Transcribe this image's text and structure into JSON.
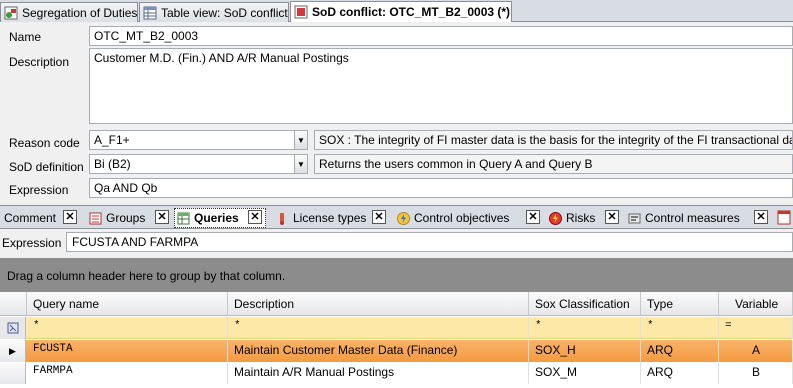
{
  "doc_tabs": [
    {
      "label": "Segregation of Duties"
    },
    {
      "label": "Table view: SoD conflict"
    },
    {
      "label": "SoD conflict: OTC_MT_B2_0003 (*)"
    }
  ],
  "form": {
    "name_label": "Name",
    "name_value": "OTC_MT_B2_0003",
    "description_label": "Description",
    "description_value": "Customer M.D. (Fin.) AND A/R Manual Postings",
    "reason_label": "Reason code",
    "reason_value": "A_F1+",
    "reason_desc": "SOX : The integrity of FI master data is the basis for the integrity of the FI transactional data base",
    "sod_label": "SoD definition",
    "sod_value": "Bi (B2)",
    "sod_desc": "Returns the users common in Query A and Query B",
    "expression_label": "Expression",
    "expression_value": "Qa AND Qb"
  },
  "sub_tabs": [
    {
      "label": "Comment"
    },
    {
      "label": "Groups"
    },
    {
      "label": "Queries"
    },
    {
      "label": "License types"
    },
    {
      "label": "Control objectives"
    },
    {
      "label": "Risks"
    },
    {
      "label": "Control measures"
    }
  ],
  "query_expression": {
    "label": "Expression",
    "value": "FCUSTA AND FARMPA"
  },
  "group_panel_text": "Drag a column header here to group by that column.",
  "grid": {
    "columns": [
      "Query name",
      "Description",
      "Sox Classification",
      "Type",
      "Variable"
    ],
    "filter": [
      "*",
      "*",
      "*",
      "*",
      "="
    ],
    "rows": [
      {
        "query": "FCUSTA",
        "description": "Maintain Customer Master Data (Finance)",
        "sox": "SOX_H",
        "type": "ARQ",
        "variable": "A"
      },
      {
        "query": "FARMPA",
        "description": "Maintain A/R Manual Postings",
        "sox": "SOX_M",
        "type": "ARQ",
        "variable": "B"
      }
    ]
  },
  "colors": {
    "selected_row": "#f59a3f",
    "filter_row": "#fde8a8",
    "group_panel": "#8c8c8c"
  }
}
